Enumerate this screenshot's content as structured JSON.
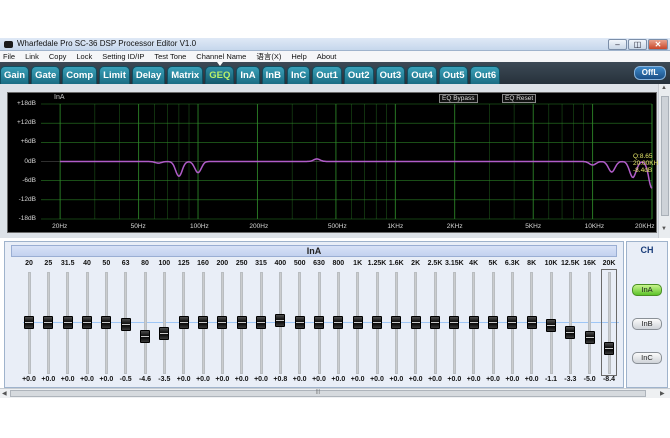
{
  "window": {
    "title": "Wharfedale Pro SC-36 DSP Processor Editor V1.0",
    "controls": {
      "minimize": "–",
      "restore": "◫",
      "close": "✕"
    }
  },
  "menu": [
    "File",
    "Link",
    "Copy",
    "Lock",
    "Setting ID/IP",
    "Test Tone",
    "Channel Name",
    "语言(X)",
    "Help",
    "About"
  ],
  "tabs": [
    {
      "label": "Gain"
    },
    {
      "label": "Gate"
    },
    {
      "label": "Comp"
    },
    {
      "label": "Limit"
    },
    {
      "label": "Delay"
    },
    {
      "label": "Matrix"
    },
    {
      "label": "GEQ",
      "active": true
    },
    {
      "label": "InA"
    },
    {
      "label": "InB"
    },
    {
      "label": "InC"
    },
    {
      "label": "Out1"
    },
    {
      "label": "Out2"
    },
    {
      "label": "Out3"
    },
    {
      "label": "Out4"
    },
    {
      "label": "Out5"
    },
    {
      "label": "Out6"
    }
  ],
  "off_button": "OffL",
  "graph": {
    "channel_label": "InA",
    "bypass_button": "EQ Bypass",
    "reset_button": "EQ Reset",
    "y_labels": [
      "+18dB",
      "+12dB",
      "+6dB",
      "0dB",
      "-6dB",
      "-12dB",
      "-18dB"
    ],
    "x_labels": [
      "20Hz",
      "50Hz",
      "100Hz",
      "200Hz",
      "500Hz",
      "1KHz",
      "2KHz",
      "5KHz",
      "10KHz",
      "20KHz"
    ],
    "marker": {
      "q": "Q:8.65",
      "freq": "20.00KHz",
      "gain": "-8.4dB"
    },
    "colors": {
      "curve": "#b05cc8",
      "grid": "#2f8a2a",
      "axis_text": "#d7d7d7"
    }
  },
  "eq": {
    "channel": "InA",
    "bands": [
      {
        "freq": "20",
        "gain": "+0.0",
        "db": 0.0
      },
      {
        "freq": "25",
        "gain": "+0.0",
        "db": 0.0
      },
      {
        "freq": "31.5",
        "gain": "+0.0",
        "db": 0.0
      },
      {
        "freq": "40",
        "gain": "+0.0",
        "db": 0.0
      },
      {
        "freq": "50",
        "gain": "+0.0",
        "db": 0.0
      },
      {
        "freq": "63",
        "gain": "-0.5",
        "db": -0.5
      },
      {
        "freq": "80",
        "gain": "-4.6",
        "db": -4.6
      },
      {
        "freq": "100",
        "gain": "-3.5",
        "db": -3.5
      },
      {
        "freq": "125",
        "gain": "+0.0",
        "db": 0.0
      },
      {
        "freq": "160",
        "gain": "+0.0",
        "db": 0.0
      },
      {
        "freq": "200",
        "gain": "+0.0",
        "db": 0.0
      },
      {
        "freq": "250",
        "gain": "+0.0",
        "db": 0.0
      },
      {
        "freq": "315",
        "gain": "+0.0",
        "db": 0.0
      },
      {
        "freq": "400",
        "gain": "+0.8",
        "db": 0.8
      },
      {
        "freq": "500",
        "gain": "+0.0",
        "db": 0.0
      },
      {
        "freq": "630",
        "gain": "+0.0",
        "db": 0.0
      },
      {
        "freq": "800",
        "gain": "+0.0",
        "db": 0.0
      },
      {
        "freq": "1K",
        "gain": "+0.0",
        "db": 0.0
      },
      {
        "freq": "1.25K",
        "gain": "+0.0",
        "db": 0.0
      },
      {
        "freq": "1.6K",
        "gain": "+0.0",
        "db": 0.0
      },
      {
        "freq": "2K",
        "gain": "+0.0",
        "db": 0.0
      },
      {
        "freq": "2.5K",
        "gain": "+0.0",
        "db": 0.0
      },
      {
        "freq": "3.15K",
        "gain": "+0.0",
        "db": 0.0
      },
      {
        "freq": "4K",
        "gain": "+0.0",
        "db": 0.0
      },
      {
        "freq": "5K",
        "gain": "+0.0",
        "db": 0.0
      },
      {
        "freq": "6.3K",
        "gain": "+0.0",
        "db": 0.0
      },
      {
        "freq": "8K",
        "gain": "+0.0",
        "db": 0.0
      },
      {
        "freq": "10K",
        "gain": "-1.1",
        "db": -1.1
      },
      {
        "freq": "12.5K",
        "gain": "-3.3",
        "db": -3.3
      },
      {
        "freq": "16K",
        "gain": "-5.0",
        "db": -5.0
      },
      {
        "freq": "20K",
        "gain": "-8.4",
        "db": -8.4,
        "selected": true
      }
    ]
  },
  "channels": {
    "title": "CH",
    "buttons": [
      {
        "label": "InA",
        "active": true
      },
      {
        "label": "InB"
      },
      {
        "label": "InC"
      }
    ]
  }
}
